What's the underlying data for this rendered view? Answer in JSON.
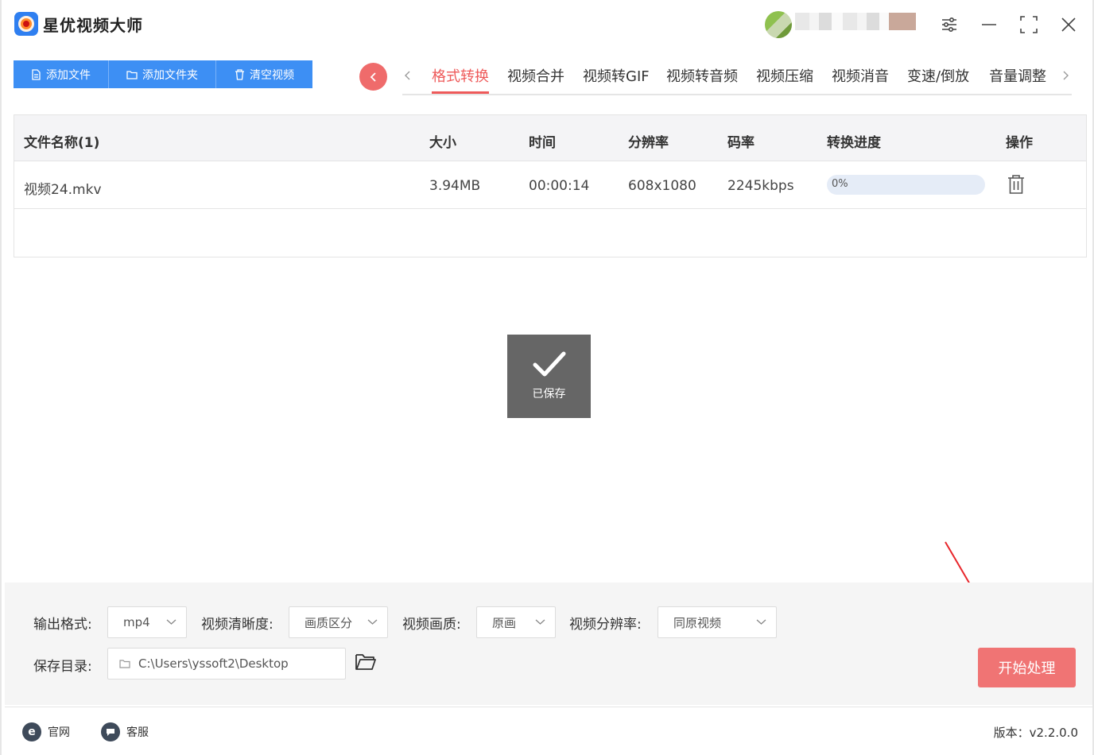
{
  "app": {
    "title": "星优视频大师"
  },
  "toolbar": {
    "add_file": "添加文件",
    "add_folder": "添加文件夹",
    "clear_videos": "清空视频"
  },
  "tabs": [
    {
      "label": "格式转换",
      "active": true
    },
    {
      "label": "视频合并",
      "active": false
    },
    {
      "label": "视频转GIF",
      "active": false
    },
    {
      "label": "视频转音频",
      "active": false
    },
    {
      "label": "视频压缩",
      "active": false
    },
    {
      "label": "视频消音",
      "active": false
    },
    {
      "label": "变速/倒放",
      "active": false
    },
    {
      "label": "音量调整",
      "active": false
    }
  ],
  "table": {
    "headers": {
      "name": "文件名称(1)",
      "size": "大小",
      "time": "时间",
      "resolution": "分辨率",
      "bitrate": "码率",
      "progress": "转换进度",
      "action": "操作"
    },
    "rows": [
      {
        "name": "视频24.mkv",
        "size": "3.94MB",
        "time": "00:00:14",
        "resolution": "608x1080",
        "bitrate": "2245kbps",
        "progress_text": "0%",
        "progress_value": 0
      }
    ]
  },
  "toast": {
    "label": "已保存"
  },
  "settings": {
    "output_format_label": "输出格式:",
    "output_format_value": "mp4",
    "clarity_label": "视频清晰度:",
    "clarity_value": "画质区分",
    "quality_label": "视频画质:",
    "quality_value": "原画",
    "resolution_label": "视频分辨率:",
    "resolution_value": "同原视频",
    "save_dir_label": "保存目录:",
    "save_dir_value": "C:\\Users\\yssoft2\\Desktop",
    "start_button": "开始处理"
  },
  "footer": {
    "official_site": "官网",
    "support": "客服",
    "version": "版本：v2.2.0.0"
  },
  "colors": {
    "primary_blue": "#3d8ff4",
    "accent_red": "#ee5a5a",
    "start_button": "#f07474"
  }
}
